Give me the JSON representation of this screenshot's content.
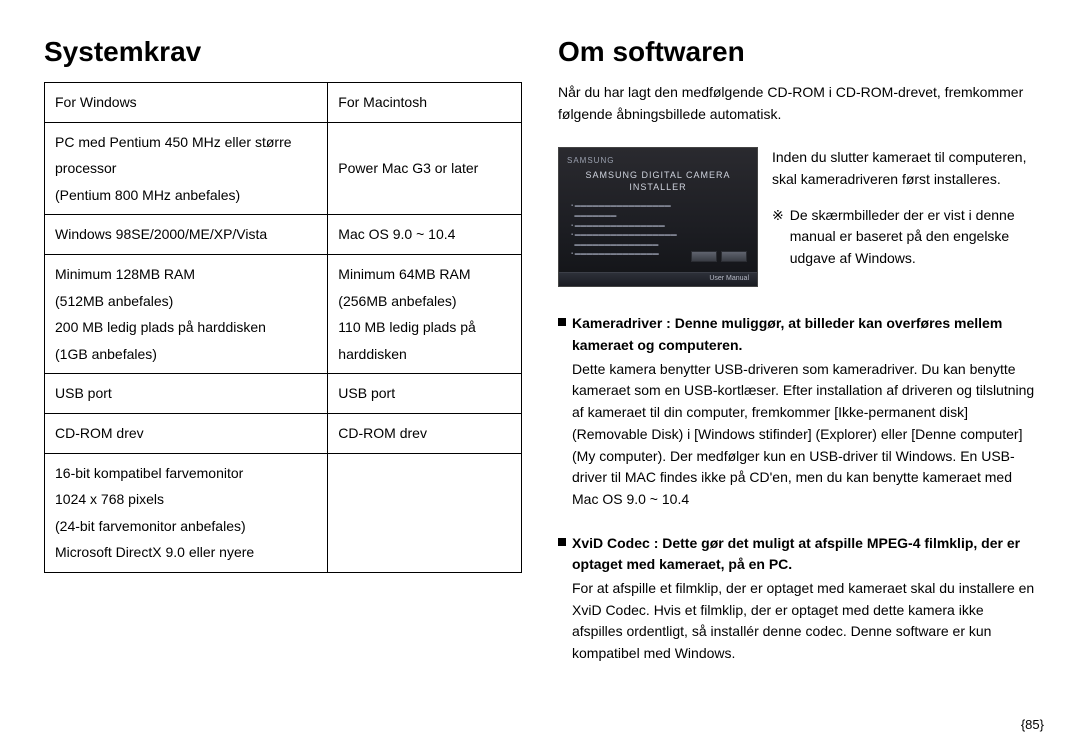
{
  "left": {
    "heading": "Systemkrav",
    "table": {
      "header": {
        "win": "For Windows",
        "mac": "For Macintosh"
      },
      "rows": [
        {
          "win": "PC med Pentium 450 MHz eller større processor\n(Pentium 800 MHz anbefales)",
          "mac": "Power Mac G3 or later"
        },
        {
          "win": "Windows 98SE/2000/ME/XP/Vista",
          "mac": "Mac OS 9.0 ~ 10.4"
        },
        {
          "win": "Minimum 128MB RAM\n(512MB anbefales)\n200 MB ledig plads på harddisken\n(1GB anbefales)",
          "mac": "Minimum 64MB RAM\n(256MB anbefales)\n110 MB ledig plads på harddisken"
        },
        {
          "win": "USB port",
          "mac": "USB port"
        },
        {
          "win": "CD-ROM drev",
          "mac": "CD-ROM drev"
        },
        {
          "win": "16-bit kompatibel farvemonitor\n1024 x 768 pixels\n(24-bit farvemonitor anbefales)\nMicrosoft DirectX 9.0 eller nyere",
          "mac": ""
        }
      ]
    }
  },
  "right": {
    "heading": "Om softwaren",
    "intro": "Når du har lagt den medfølgende CD-ROM i CD-ROM-drevet, fremkommer følgende åbningsbillede automatisk.",
    "installer": {
      "brand": "SAMSUNG",
      "title1": "SAMSUNG DIGITAL CAMERA",
      "title2": "INSTALLER",
      "bar_text": "User Manual"
    },
    "sidetext": "Inden du slutter kameraet til computeren, skal kameradriveren først installeres.",
    "note_star": "※",
    "note_text": "De skærmbilleder der er vist i denne manual er baseret på den engelske udgave af Windows.",
    "bullets": [
      {
        "lead": "Kameradriver : Denne muliggør, at billeder kan overføres mellem kameraet og computeren.",
        "body": "Dette kamera benytter USB-driveren som kameradriver. Du kan benytte kameraet som en USB-kortlæser. Efter installation af driveren og tilslutning af kameraet til din computer, fremkommer [Ikke-permanent disk] (Removable Disk) i [Windows stifinder] (Explorer) eller [Denne computer] (My computer). Der medfølger kun en USB-driver til Windows. En USB-driver til MAC findes ikke på CD'en, men du kan benytte kameraet med Mac OS 9.0 ~ 10.4"
      },
      {
        "lead": "XviD Codec : Dette gør det muligt at afspille MPEG-4 filmklip, der er optaget med kameraet, på en PC.",
        "body": "For at afspille et filmklip, der er optaget med kameraet skal du installere en XviD Codec. Hvis et filmklip, der er optaget med dette kamera ikke afspilles ordentligt, så installér denne codec. Denne software er kun kompatibel med Windows."
      }
    ]
  },
  "page_number": "{85}"
}
